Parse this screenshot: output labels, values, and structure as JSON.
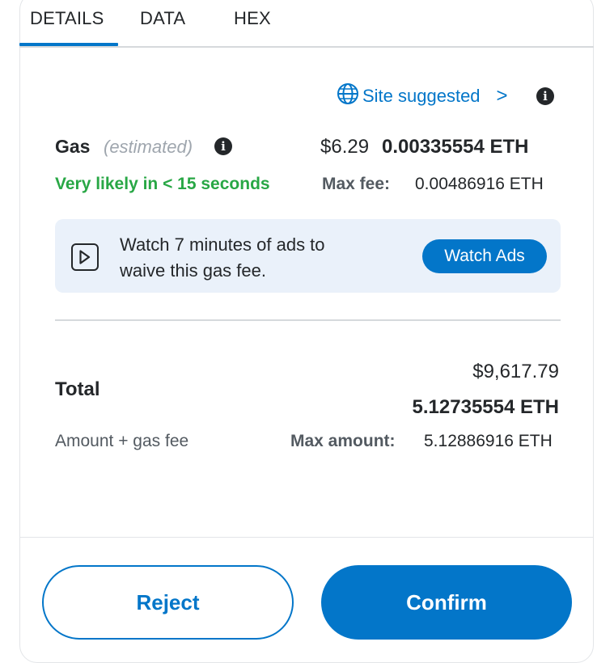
{
  "tabs": [
    {
      "label": "DETAILS",
      "active": true
    },
    {
      "label": "DATA",
      "active": false
    },
    {
      "label": "HEX",
      "active": false
    }
  ],
  "site_suggested": {
    "label": "Site suggested",
    "chevron": ">",
    "icon": "globe-icon"
  },
  "gas": {
    "label": "Gas",
    "estimated": "(estimated)",
    "usd": "$6.29",
    "eth": "0.00335554 ETH",
    "likely": "Very likely in < 15 seconds",
    "max_fee_label": "Max fee:",
    "max_fee_value": "0.00486916 ETH"
  },
  "ads": {
    "line1": "Watch 7 minutes of ads to",
    "line2": "waive this gas fee.",
    "button": "Watch Ads"
  },
  "total": {
    "label": "Total",
    "usd": "$9,617.79",
    "eth": "5.12735554 ETH",
    "sublabel": "Amount + gas fee",
    "max_amount_label": "Max amount:",
    "max_amount_value": "5.12886916 ETH"
  },
  "footer": {
    "reject": "Reject",
    "confirm": "Confirm"
  },
  "colors": {
    "accent": "#0376c9",
    "success": "#28a745",
    "banner_bg": "#eaf1fa"
  }
}
